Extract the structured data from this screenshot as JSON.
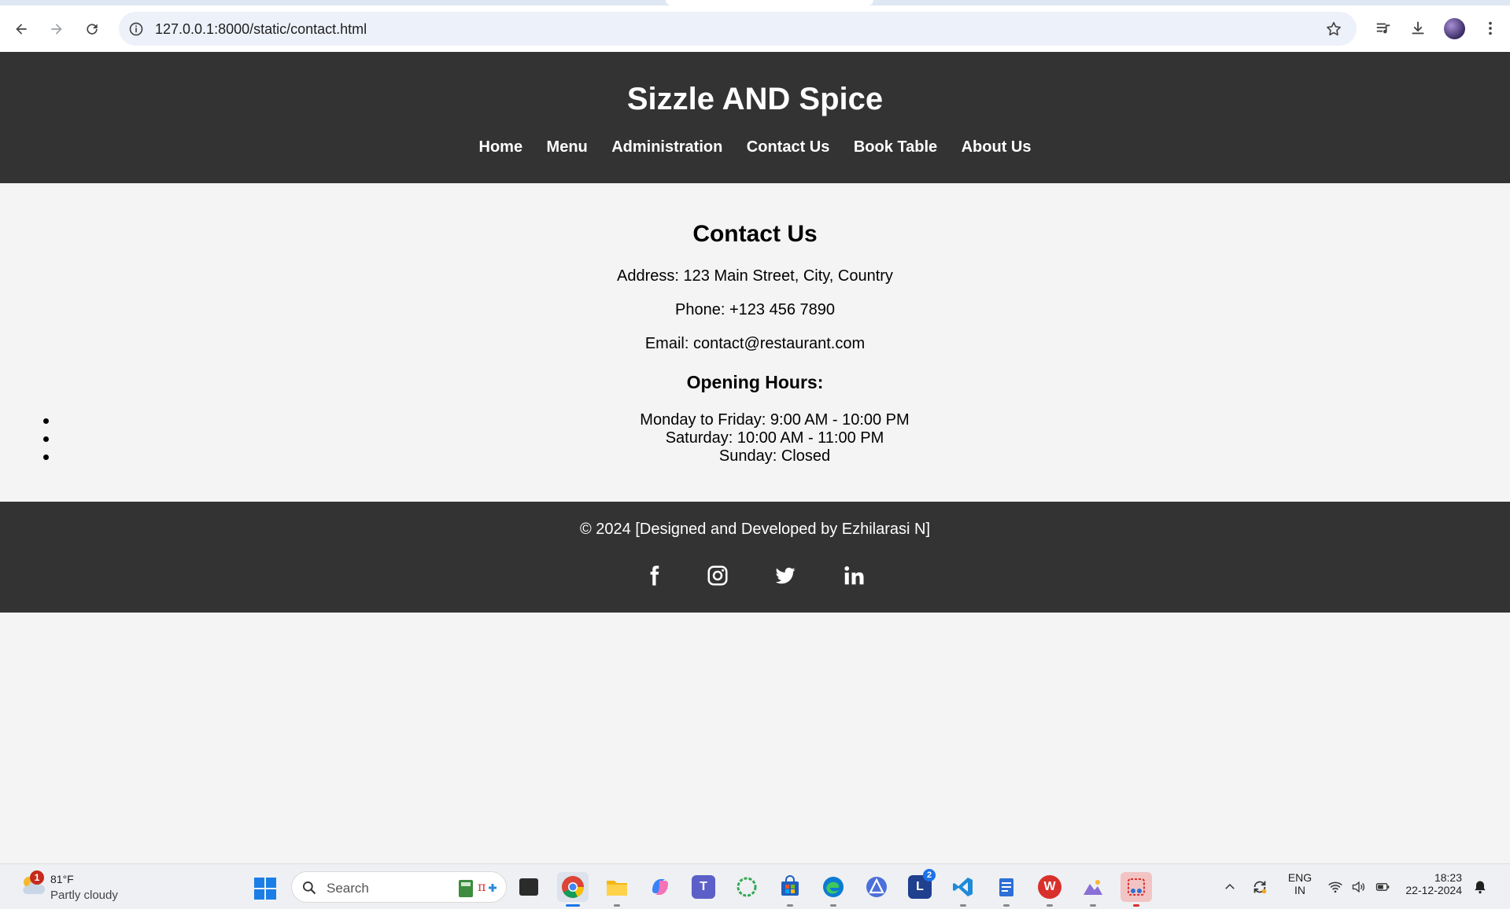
{
  "browser": {
    "url": "127.0.0.1:8000/static/contact.html"
  },
  "site": {
    "title": "Sizzle AND Spice",
    "nav": [
      "Home",
      "Menu",
      "Administration",
      "Contact Us",
      "Book Table",
      "About Us"
    ]
  },
  "contact": {
    "heading": "Contact Us",
    "address": "Address: 123 Main Street, City, Country",
    "phone": "Phone: +123 456 7890",
    "email": "Email: contact@restaurant.com",
    "hours_heading": "Opening Hours:",
    "hours": [
      "Monday to Friday: 9:00 AM - 10:00 PM",
      "Saturday: 10:00 AM - 11:00 PM",
      "Sunday: Closed"
    ]
  },
  "footer": {
    "copyright": "© 2024 [Designed and Developed by Ezhilarasi N]",
    "social_icons": [
      "facebook-icon",
      "instagram-icon",
      "twitter-icon",
      "linkedin-icon"
    ]
  },
  "taskbar": {
    "weather": {
      "temp": "81°F",
      "desc": "Partly cloudy",
      "badge": "1"
    },
    "search_placeholder": "Search",
    "apps": [
      "file-manager-icon",
      "chrome-icon",
      "file-explorer-icon",
      "copilot-icon",
      "teams-icon",
      "loader-app-icon",
      "store-icon",
      "edge-icon",
      "delta-app-icon",
      "l-app-icon",
      "vscode-icon",
      "notepad-icon",
      "wps-icon",
      "paint-icon",
      "snipping-tool-icon"
    ],
    "l_app_badge": "2",
    "lang_top": "ENG",
    "lang_bottom": "IN",
    "time": "18:23",
    "date": "22-12-2024"
  },
  "colors": {
    "header_bg": "#333333",
    "page_bg": "#f4f4f4",
    "text_light": "#ffffff"
  }
}
